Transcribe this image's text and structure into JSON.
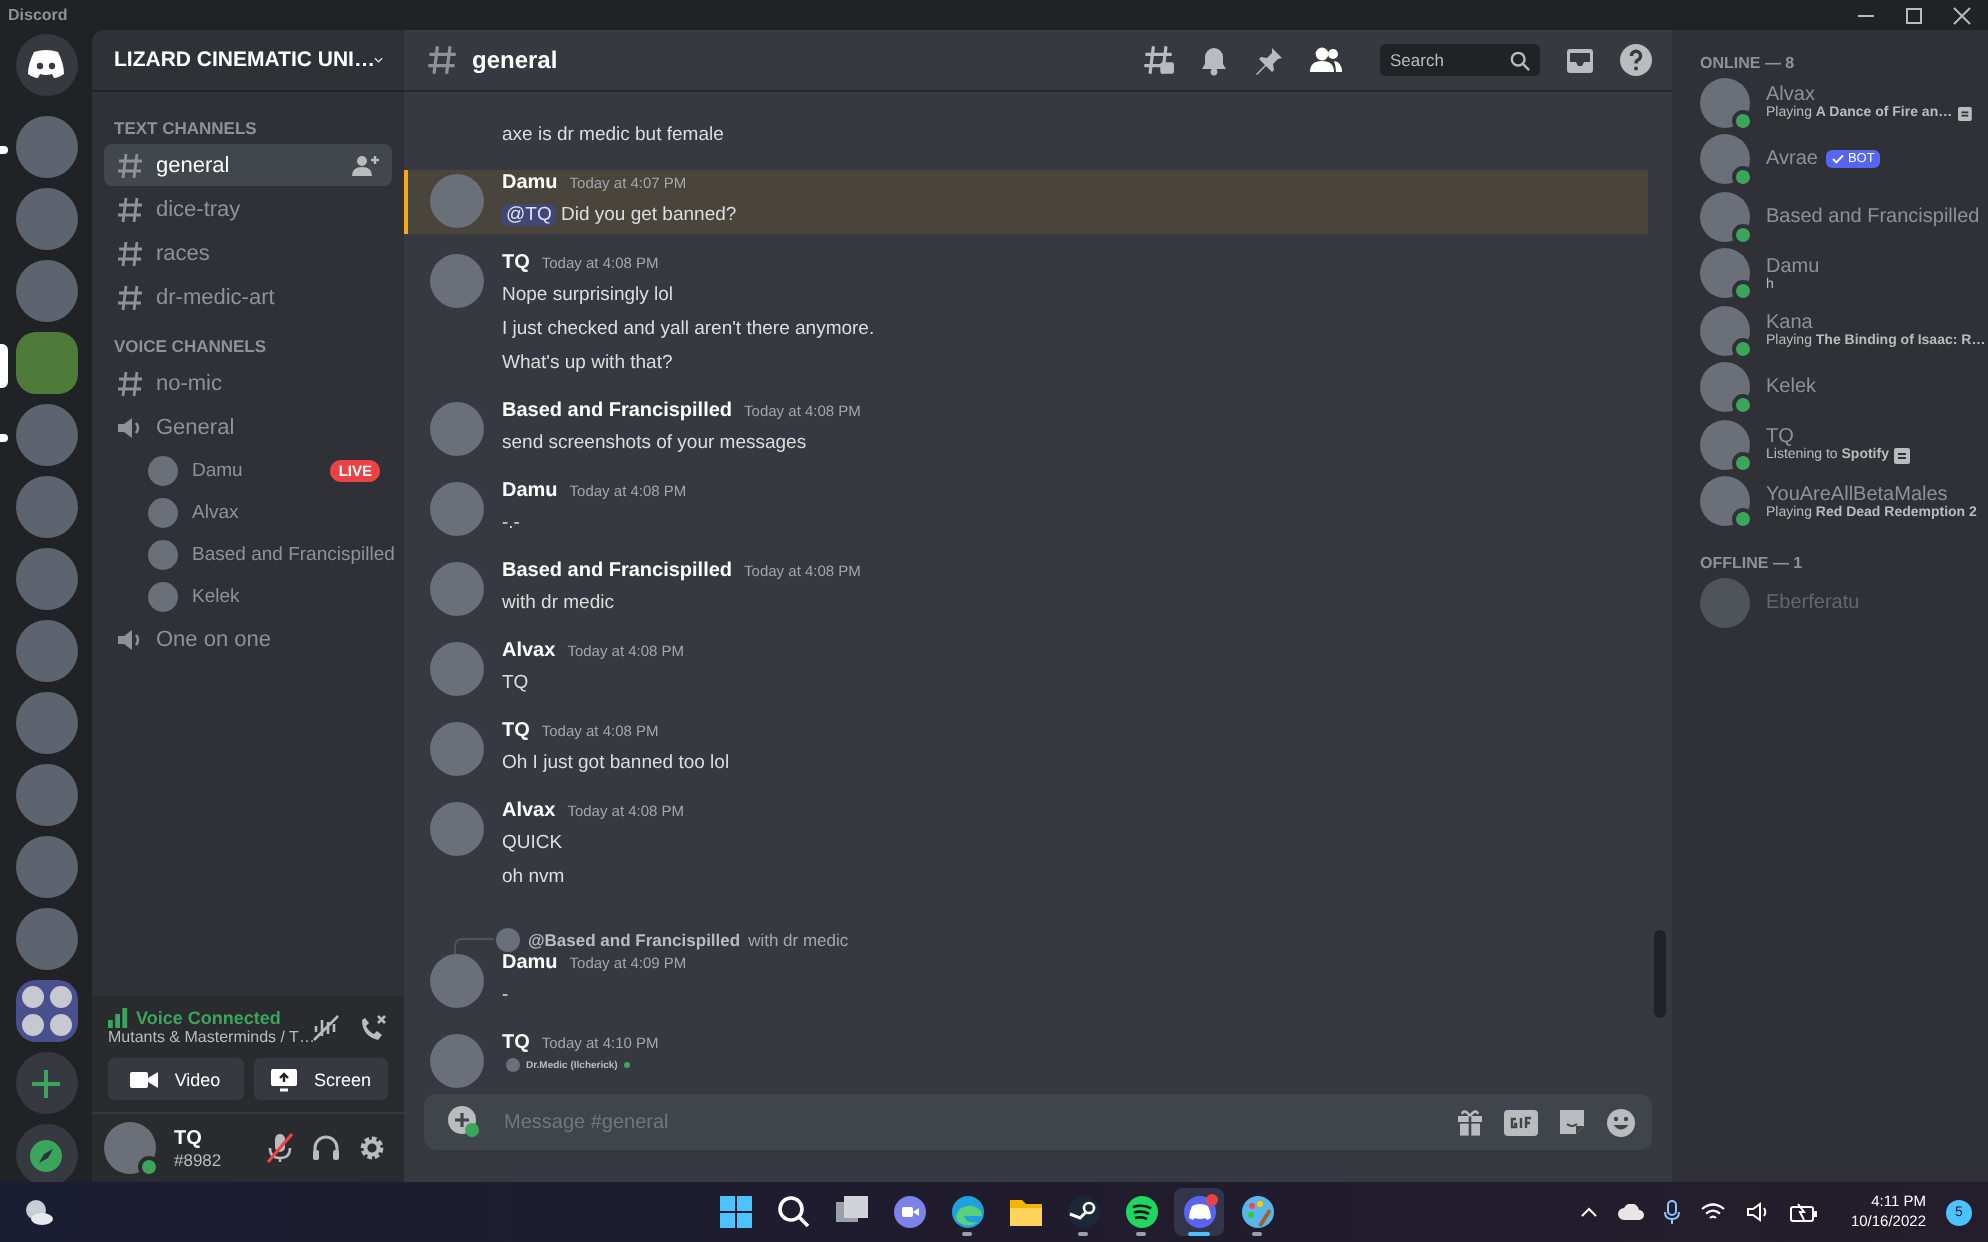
{
  "window": {
    "title": "Discord"
  },
  "servers": [
    {
      "kind": "home",
      "selected": false,
      "unread": false
    },
    {
      "kind": "server",
      "selected": false,
      "unread": true
    },
    {
      "kind": "server",
      "selected": false,
      "unread": false
    },
    {
      "kind": "server",
      "selected": false,
      "unread": false
    },
    {
      "kind": "server",
      "selected": true,
      "unread": false
    },
    {
      "kind": "server",
      "selected": false,
      "unread": true
    },
    {
      "kind": "server",
      "selected": false,
      "unread": false
    },
    {
      "kind": "server",
      "selected": false,
      "unread": false
    },
    {
      "kind": "server",
      "selected": false,
      "unread": false
    },
    {
      "kind": "server",
      "selected": false,
      "unread": false
    },
    {
      "kind": "server",
      "selected": false,
      "unread": false
    },
    {
      "kind": "server",
      "selected": false,
      "unread": false
    },
    {
      "kind": "server",
      "selected": false,
      "unread": false
    },
    {
      "kind": "folder",
      "selected": false,
      "unread": false
    },
    {
      "kind": "add",
      "selected": false,
      "unread": false
    },
    {
      "kind": "explore",
      "selected": false,
      "unread": false
    }
  ],
  "guild": {
    "name": "LIZARD CINEMATIC UNI…"
  },
  "categories": [
    {
      "name": "TEXT CHANNELS",
      "channels": [
        {
          "kind": "text",
          "name": "general",
          "selected": true
        },
        {
          "kind": "text",
          "name": "dice-tray",
          "selected": false
        },
        {
          "kind": "text",
          "name": "races",
          "selected": false
        },
        {
          "kind": "text",
          "name": "dr-medic-art",
          "selected": false
        }
      ]
    },
    {
      "name": "VOICE CHANNELS",
      "channels": [
        {
          "kind": "text",
          "name": "no-mic",
          "selected": false
        },
        {
          "kind": "voice",
          "name": "General",
          "selected": false,
          "users": [
            {
              "name": "Damu",
              "live": "LIVE"
            },
            {
              "name": "Alvax"
            },
            {
              "name": "Based and Francispilled"
            },
            {
              "name": "Kelek"
            }
          ]
        },
        {
          "kind": "voice",
          "name": "One on one",
          "selected": false
        }
      ]
    }
  ],
  "voice_panel": {
    "status": "Voice Connected",
    "location": "Mutants & Masterminds / T…",
    "buttons": [
      "Video",
      "Screen"
    ]
  },
  "user_panel": {
    "name": "TQ",
    "tag": "#8982",
    "mic_muted": true
  },
  "header": {
    "channel": "general",
    "search": {
      "placeholder": "Search"
    }
  },
  "messages": [
    {
      "lines": [
        "axe is dr medic but female"
      ],
      "highlighted": false
    },
    {
      "author": "Damu",
      "time": "Today at 4:07 PM",
      "mention": "@TQ",
      "lines": [
        "Did you get banned?"
      ],
      "highlighted": true
    },
    {
      "author": "TQ",
      "time": "Today at 4:08 PM",
      "lines": [
        "Nope surprisingly lol",
        "I just checked and yall aren't there anymore.",
        "What's up with that?"
      ],
      "highlighted": false
    },
    {
      "author": "Based and Francispilled",
      "time": "Today at 4:08 PM",
      "lines": [
        "send screenshots of your messages"
      ],
      "highlighted": false
    },
    {
      "author": "Damu",
      "time": "Today at 4:08 PM",
      "lines": [
        "-.-"
      ],
      "highlighted": false
    },
    {
      "author": "Based and Francispilled",
      "time": "Today at 4:08 PM",
      "lines": [
        "with dr medic"
      ],
      "highlighted": false
    },
    {
      "author": "Alvax",
      "time": "Today at 4:08 PM",
      "lines": [
        "TQ"
      ],
      "highlighted": false
    },
    {
      "author": "TQ",
      "time": "Today at 4:08 PM",
      "lines": [
        "Oh I just got banned too lol"
      ],
      "highlighted": false
    },
    {
      "author": "Alvax",
      "time": "Today at 4:08 PM",
      "lines": [
        "QUICK",
        "oh nvm"
      ],
      "highlighted": false
    },
    {
      "reply": {
        "author": "@Based and Francispilled",
        "text": "with dr medic"
      },
      "author": "Damu",
      "time": "Today at 4:09 PM",
      "lines": [
        "-"
      ],
      "highlighted": false
    },
    {
      "author": "TQ",
      "time": "Today at 4:10 PM",
      "embed": "Dr.Medic (Ilcherick)",
      "highlighted": false
    }
  ],
  "composer": {
    "placeholder": "Message #general"
  },
  "member_sections": [
    {
      "heading": "ONLINE — 8",
      "offline": false,
      "members": [
        {
          "name": "Alvax",
          "activity": "Playing **A Dance of Fire an…**",
          "rich_icon": true
        },
        {
          "name": "Avrae",
          "bot": "BOT"
        },
        {
          "name": "Based and Francispilled"
        },
        {
          "name": "Damu",
          "activity": "h"
        },
        {
          "name": "Kana",
          "activity": "Playing **The Binding of Isaac: R…**"
        },
        {
          "name": "Kelek"
        },
        {
          "name": "TQ",
          "activity": "Listening to **Spotify**",
          "rich_icon": true
        },
        {
          "name": "YouAreAllBetaMales",
          "activity": "Playing **Red Dead Redemption 2**"
        }
      ]
    },
    {
      "heading": "OFFLINE — 1",
      "offline": true,
      "members": [
        {
          "name": "Eberferatu"
        }
      ]
    }
  ],
  "taskbar": {
    "apps": [
      {
        "kind": "start",
        "running": false,
        "active": false
      },
      {
        "kind": "search",
        "running": false,
        "active": false
      },
      {
        "kind": "taskview",
        "running": false,
        "active": false
      },
      {
        "kind": "chat",
        "running": false,
        "active": false
      },
      {
        "kind": "edge",
        "running": true,
        "active": false
      },
      {
        "kind": "files",
        "running": false,
        "active": false
      },
      {
        "kind": "steam",
        "running": true,
        "active": false
      },
      {
        "kind": "spotify",
        "running": true,
        "active": false
      },
      {
        "kind": "discord",
        "running": true,
        "active": true
      },
      {
        "kind": "paint",
        "running": true,
        "active": false
      }
    ],
    "time": "4:11 PM",
    "date": "10/16/2022",
    "notifications": "5"
  }
}
